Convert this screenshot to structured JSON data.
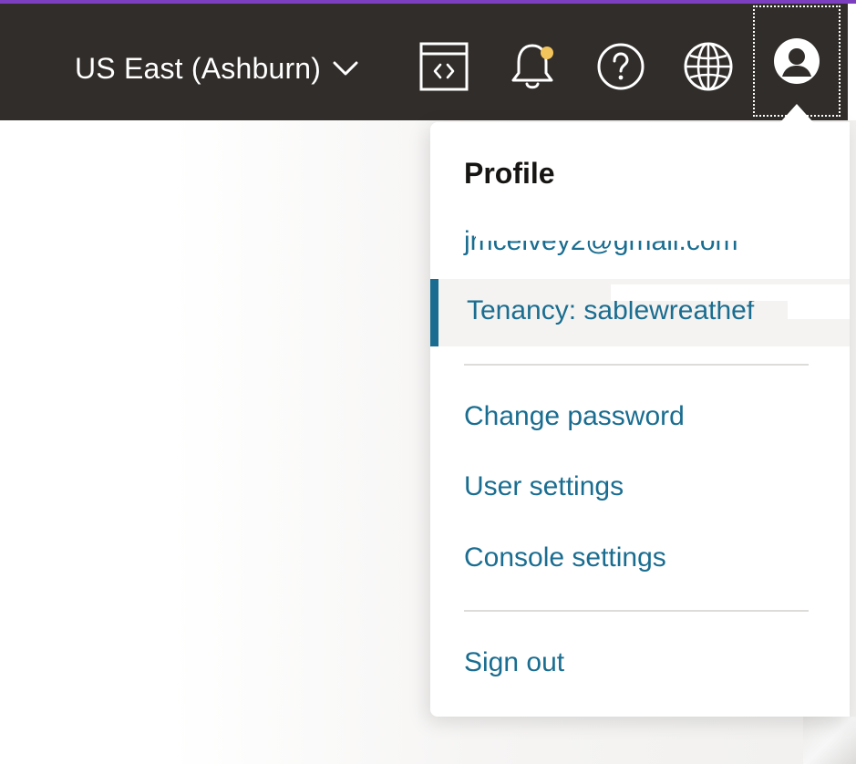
{
  "header": {
    "region_label": "US East (Ashburn)",
    "icons": [
      "developer-tools-icon",
      "notifications-bell-icon",
      "help-icon",
      "language-globe-icon",
      "user-profile-icon"
    ],
    "colors": {
      "bar_background": "#312d2a",
      "accent_line": "#7c3fbf",
      "notification_dot": "#f2c45c"
    }
  },
  "profile_menu": {
    "title": "Profile",
    "email": "jmcelvey2@gmail.com",
    "tenancy_label": "Tenancy: sablewreathef",
    "items": {
      "change_password": "Change password",
      "user_settings": "User settings",
      "console_settings": "Console settings",
      "sign_out": "Sign out"
    },
    "colors": {
      "link": "#1a6d90",
      "selected_row_bg": "#f4f3f1"
    }
  }
}
